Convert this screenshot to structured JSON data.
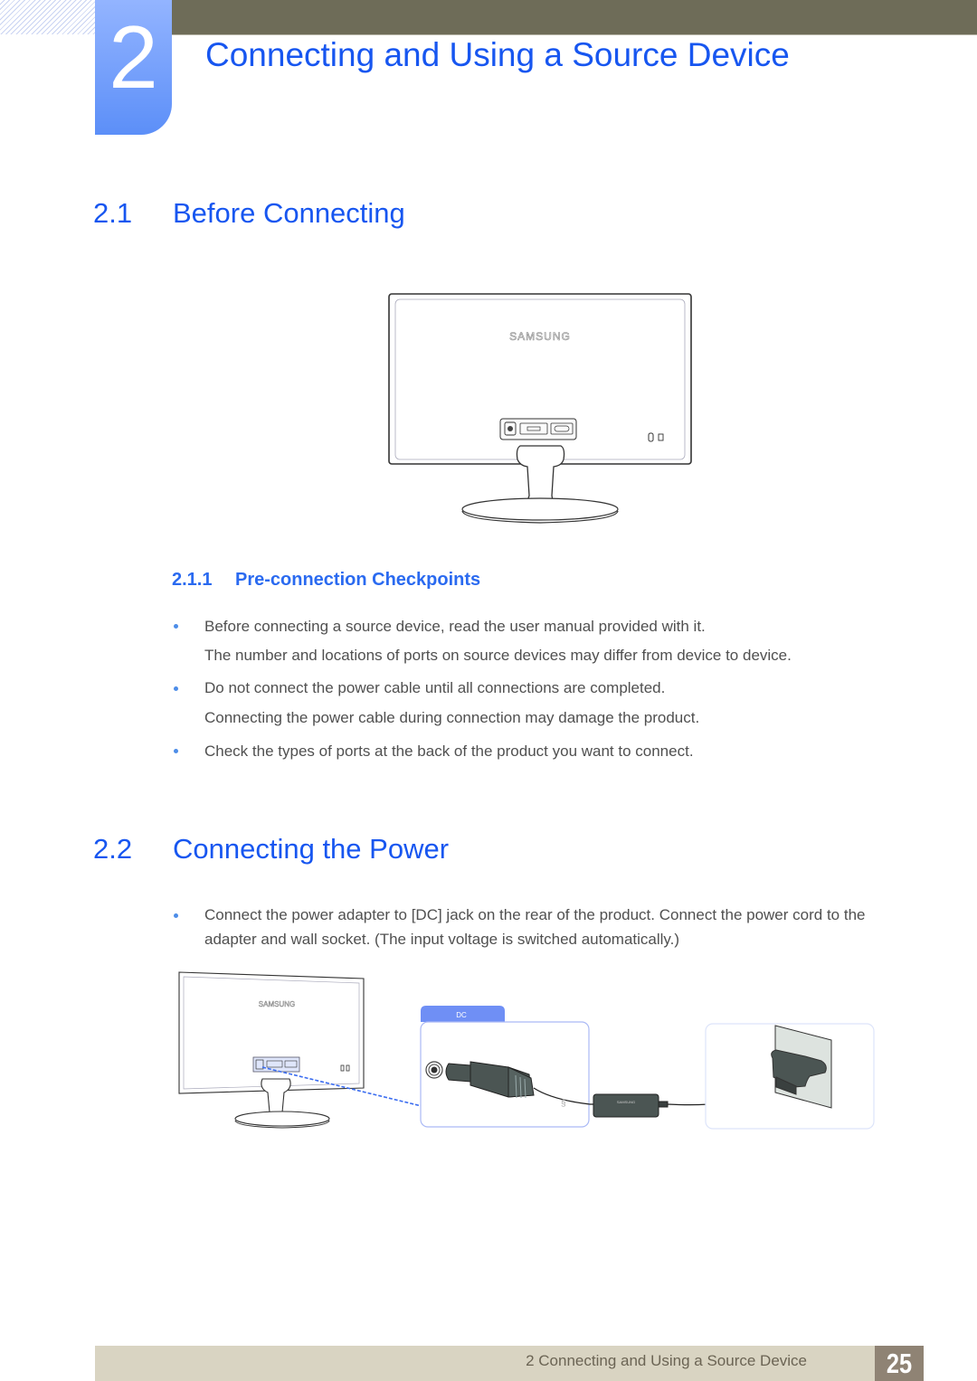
{
  "chapter": {
    "number": "2",
    "title": "Connecting and Using a Source Device"
  },
  "sections": [
    {
      "number": "2.1",
      "title": "Before Connecting",
      "figure": {
        "brand_label": "SAMSUNG",
        "icon": "monitor-rear-view"
      },
      "subsections": [
        {
          "number": "2.1.1",
          "title": "Pre-connection Checkpoints",
          "items": [
            {
              "text": "Before connecting a source device, read the user manual provided with it.",
              "note": "The number and locations of ports on source devices may differ from device to device."
            },
            {
              "text": "Do not connect the power cable until all connections are completed.",
              "note": "Connecting the power cable during connection may damage the product."
            },
            {
              "text": "Check the types of ports at the back of the product you want to connect."
            }
          ]
        }
      ]
    },
    {
      "number": "2.2",
      "title": "Connecting the Power",
      "items": [
        {
          "line1": "Connect the power adapter to [DC] jack on the rear of the product. Connect the power cord to the",
          "line2": "adapter and wall socket. (The input voltage is switched automatically.)"
        }
      ],
      "figure": {
        "brand_label": "SAMSUNG",
        "callout_tab_label": "DC",
        "adapter_label": "SAMSUNG",
        "icons": [
          "monitor-rear-view",
          "dc-jack",
          "dc-plug",
          "power-adapter",
          "wall-socket-plug"
        ]
      }
    }
  ],
  "footer": {
    "running_title": "2 Connecting and Using a Source Device",
    "page_number": "25"
  },
  "colors": {
    "heading_blue": "#1756f0",
    "badge_blue": "#5c8ff8",
    "top_bar": "#6e6c58",
    "footer_bg": "#d9d4c2",
    "page_box": "#8f8374",
    "bullet": "#4d8de8"
  }
}
